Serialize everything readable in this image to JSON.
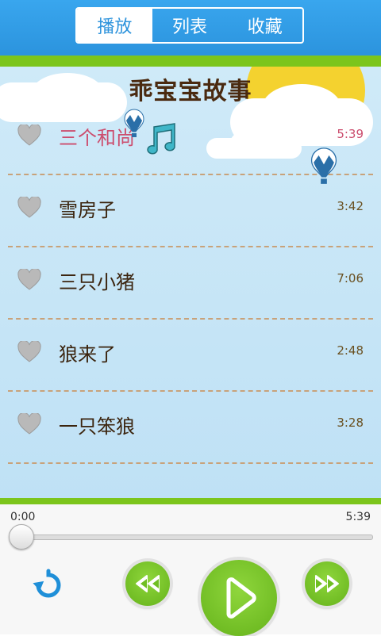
{
  "tabs": {
    "play": "播放",
    "list": "列表",
    "favorites": "收藏",
    "active": "play"
  },
  "title": "乖宝宝故事",
  "songs": [
    {
      "name": "三个和尚",
      "duration": "5:39",
      "playing": true
    },
    {
      "name": "雪房子",
      "duration": "3:42",
      "playing": false
    },
    {
      "name": "三只小猪",
      "duration": "7:06",
      "playing": false
    },
    {
      "name": "狼来了",
      "duration": "2:48",
      "playing": false
    },
    {
      "name": "一只笨狼",
      "duration": "3:28",
      "playing": false
    }
  ],
  "player": {
    "current_time": "0:00",
    "total_time": "5:39",
    "progress": 0
  },
  "colors": {
    "header": "#2d93dc",
    "green": "#7cc51c",
    "active_text": "#cc4d6e",
    "sun": "#f4d22f"
  }
}
